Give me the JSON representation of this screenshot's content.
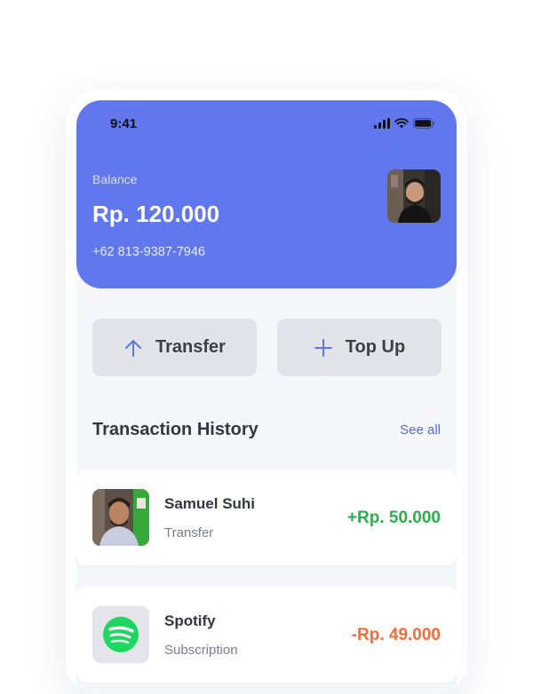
{
  "status_bar": {
    "time": "9:41"
  },
  "header": {
    "balance_label": "Balance",
    "balance_value": "Rp. 120.000",
    "phone_number": "+62 813-9387-7946"
  },
  "actions": [
    {
      "label": "Transfer",
      "icon": "arrow-up-icon"
    },
    {
      "label": "Top Up",
      "icon": "plus-icon"
    }
  ],
  "transactions_section": {
    "title": "Transaction History",
    "see_all": "See all"
  },
  "transactions": [
    {
      "name": "Samuel Suhi",
      "type": "Transfer",
      "amount": "+Rp. 50.000",
      "direction": "in"
    },
    {
      "name": "Spotify",
      "type": "Subscription",
      "amount": "-Rp. 49.000",
      "direction": "out"
    }
  ],
  "colors": {
    "primary": "#6077ee",
    "income": "#27b04e",
    "expense": "#f26b3a",
    "link": "#5669dd",
    "spotify": "#1ed760"
  }
}
